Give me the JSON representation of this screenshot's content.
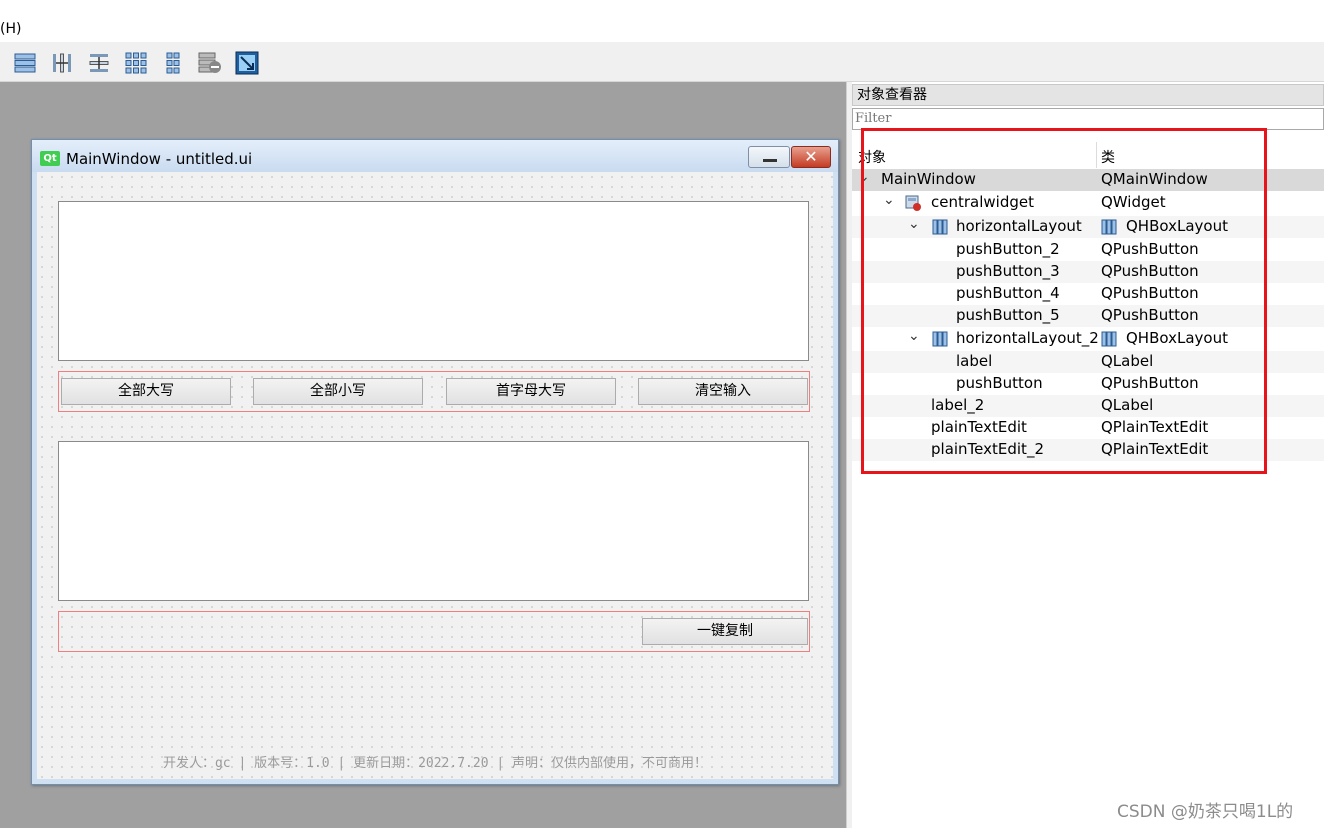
{
  "menubar": {
    "help_label": "(H)"
  },
  "toolbar": {
    "tools": [
      {
        "icon": "layout-vertical-icon"
      },
      {
        "icon": "splitter-horizontal-icon"
      },
      {
        "icon": "splitter-vertical-icon"
      },
      {
        "icon": "grid-layout-icon"
      },
      {
        "icon": "form-layout-icon"
      },
      {
        "icon": "break-layout-icon"
      },
      {
        "icon": "adjust-size-icon"
      }
    ]
  },
  "form": {
    "logo_text": "Qt",
    "title": "MainWindow - untitled.ui",
    "close_glyph": "✕",
    "buttons_row1": [
      "全部大写",
      "全部小写",
      "首字母大写",
      "清空输入"
    ],
    "copy_button": "一键复制",
    "footer": "开发人：gc | 版本号：1.0 | 更新日期：2022.7.20 | 声明：仅供内部使用，不可商用！"
  },
  "inspector": {
    "title": "对象查看器",
    "filter_placeholder": "Filter",
    "col_object": "对象",
    "col_class": "类",
    "rows": [
      {
        "name": "MainWindow",
        "cls": "QMainWindow"
      },
      {
        "name": "centralwidget",
        "cls": "QWidget"
      },
      {
        "name": "horizontalLayout",
        "cls": "QHBoxLayout"
      },
      {
        "name": "pushButton_2",
        "cls": "QPushButton"
      },
      {
        "name": "pushButton_3",
        "cls": "QPushButton"
      },
      {
        "name": "pushButton_4",
        "cls": "QPushButton"
      },
      {
        "name": "pushButton_5",
        "cls": "QPushButton"
      },
      {
        "name": "horizontalLayout_2",
        "cls": "QHBoxLayout"
      },
      {
        "name": "label",
        "cls": "QLabel"
      },
      {
        "name": "pushButton",
        "cls": "QPushButton"
      },
      {
        "name": "label_2",
        "cls": "QLabel"
      },
      {
        "name": "plainTextEdit",
        "cls": "QPlainTextEdit"
      },
      {
        "name": "plainTextEdit_2",
        "cls": "QPlainTextEdit"
      }
    ]
  },
  "watermark": "CSDN @奶茶只喝1L的",
  "colors": {
    "highlight": "#e8141b",
    "layout_border": "#f08080",
    "canvas": "#a0a0a0"
  }
}
